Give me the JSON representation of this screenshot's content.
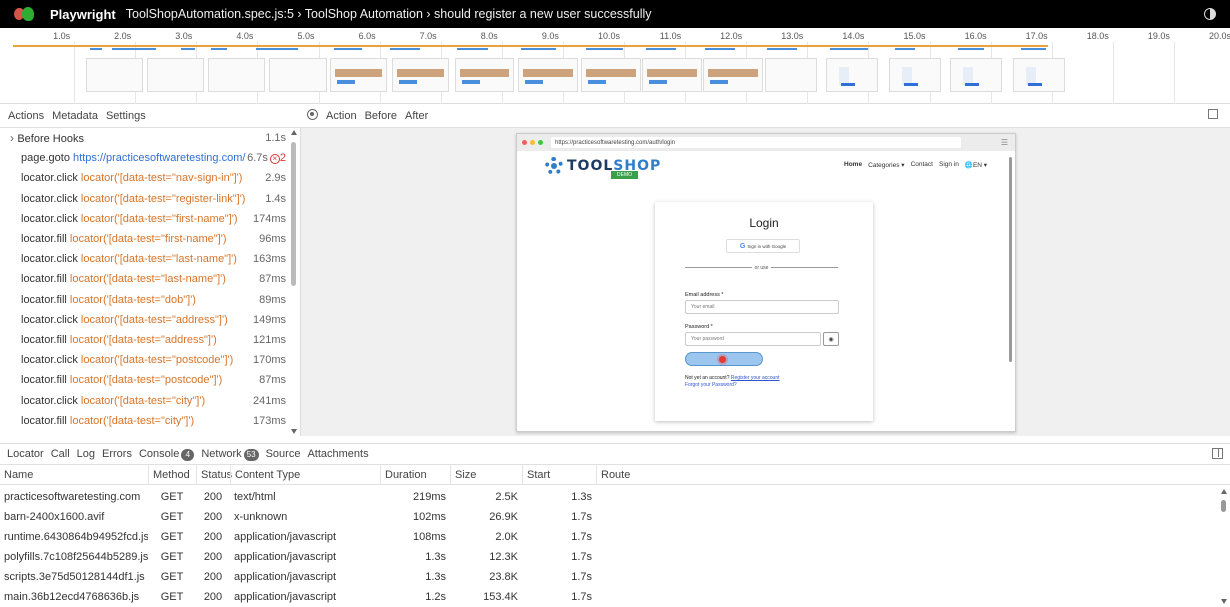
{
  "titlebar": {
    "app": "Playwright",
    "breadcrumb": "ToolShopAutomation.spec.js:5 › ToolShop Automation › should register a new user successfully"
  },
  "timeline": {
    "ticks": [
      "1.0s",
      "2.0s",
      "3.0s",
      "4.0s",
      "5.0s",
      "6.0s",
      "7.0s",
      "8.0s",
      "9.0s",
      "10.0s",
      "11.0s",
      "12.0s",
      "13.0s",
      "14.0s",
      "15.0s",
      "16.0s",
      "17.0s",
      "18.0s",
      "19.0s",
      "20.0s"
    ]
  },
  "left_tabs": [
    "Actions",
    "Metadata",
    "Settings"
  ],
  "right_tabs": [
    "Action",
    "Before",
    "After"
  ],
  "actions": [
    {
      "method": "Before Hooks",
      "target": "",
      "duration": "1.1s",
      "kind": "hook"
    },
    {
      "method": "page.goto",
      "target": "https://practicesoftwaretesting.com/",
      "duration": "6.7s",
      "kind": "url",
      "errors": "2"
    },
    {
      "method": "locator.click",
      "target": "locator('[data-test=\"nav-sign-in\"]')",
      "duration": "2.9s",
      "kind": "loc"
    },
    {
      "method": "locator.click",
      "target": "locator('[data-test=\"register-link\"]')",
      "duration": "1.4s",
      "kind": "loc"
    },
    {
      "method": "locator.click",
      "target": "locator('[data-test=\"first-name\"]')",
      "duration": "174ms",
      "kind": "loc"
    },
    {
      "method": "locator.fill",
      "target": "locator('[data-test=\"first-name\"]')",
      "duration": "96ms",
      "kind": "loc"
    },
    {
      "method": "locator.click",
      "target": "locator('[data-test=\"last-name\"]')",
      "duration": "163ms",
      "kind": "loc"
    },
    {
      "method": "locator.fill",
      "target": "locator('[data-test=\"last-name\"]')",
      "duration": "87ms",
      "kind": "loc"
    },
    {
      "method": "locator.fill",
      "target": "locator('[data-test=\"dob\"]')",
      "duration": "89ms",
      "kind": "loc"
    },
    {
      "method": "locator.click",
      "target": "locator('[data-test=\"address\"]')",
      "duration": "149ms",
      "kind": "loc"
    },
    {
      "method": "locator.fill",
      "target": "locator('[data-test=\"address\"]')",
      "duration": "121ms",
      "kind": "loc"
    },
    {
      "method": "locator.click",
      "target": "locator('[data-test=\"postcode\"]')",
      "duration": "170ms",
      "kind": "loc"
    },
    {
      "method": "locator.fill",
      "target": "locator('[data-test=\"postcode\"]')",
      "duration": "87ms",
      "kind": "loc"
    },
    {
      "method": "locator.click",
      "target": "locator('[data-test=\"city\"]')",
      "duration": "241ms",
      "kind": "loc"
    },
    {
      "method": "locator.fill",
      "target": "locator('[data-test=\"city\"]')",
      "duration": "173ms",
      "kind": "loc"
    }
  ],
  "snapshot": {
    "url": "https://practicesoftwaretesting.com/auth/login",
    "logo_a": "TOOL",
    "logo_b": "SHOP",
    "demo": "DEMO",
    "nav": [
      "Home",
      "Categories ▾",
      "Contact",
      "Sign in",
      "🌐EN ▾"
    ],
    "login_title": "Login",
    "google_btn": "Sign in with Google",
    "or_use": "or use",
    "email_label": "Email address *",
    "email_placeholder": "Your email",
    "password_label": "Password *",
    "password_placeholder": "Your password",
    "not_yet": "Not yet an account?",
    "register_link": "Register your account",
    "forgot": "Forgot your Password?"
  },
  "bottom_tabs": [
    {
      "label": "Locator"
    },
    {
      "label": "Call"
    },
    {
      "label": "Log"
    },
    {
      "label": "Errors"
    },
    {
      "label": "Console",
      "count": "4"
    },
    {
      "label": "Network",
      "count": "53"
    },
    {
      "label": "Source"
    },
    {
      "label": "Attachments"
    }
  ],
  "network": {
    "columns": [
      "Name",
      "Method",
      "Status",
      "Content Type",
      "Duration",
      "Size",
      "Start",
      "Route"
    ],
    "rows": [
      [
        "practicesoftwaretesting.com",
        "GET",
        "200",
        "text/html",
        "219ms",
        "2.5K",
        "1.3s",
        ""
      ],
      [
        "barn-2400x1600.avif",
        "GET",
        "200",
        "x-unknown",
        "102ms",
        "26.9K",
        "1.7s",
        ""
      ],
      [
        "runtime.6430864b94952fcd.js",
        "GET",
        "200",
        "application/javascript",
        "108ms",
        "2.0K",
        "1.7s",
        ""
      ],
      [
        "polyfills.7c108f25644b5289.js",
        "GET",
        "200",
        "application/javascript",
        "1.3s",
        "12.3K",
        "1.7s",
        ""
      ],
      [
        "scripts.3e75d50128144df1.js",
        "GET",
        "200",
        "application/javascript",
        "1.3s",
        "23.8K",
        "1.7s",
        ""
      ],
      [
        "main.36b12ecd4768636b.js",
        "GET",
        "200",
        "application/javascript",
        "1.2s",
        "153.4K",
        "1.7s",
        ""
      ]
    ]
  },
  "colors": {
    "locator": "#d8752a",
    "url": "#2f6fd6",
    "timeline": "#e8a33a"
  }
}
